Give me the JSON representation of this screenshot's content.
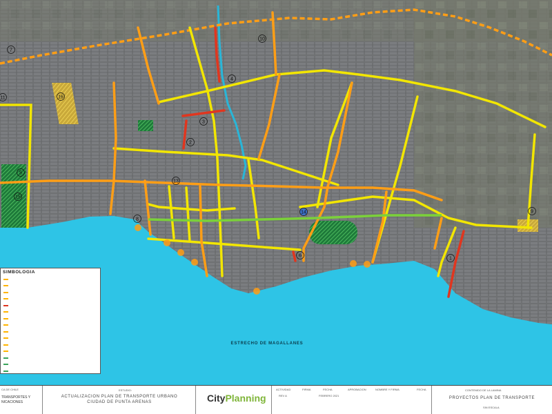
{
  "map": {
    "road_labels": [
      "1",
      "2",
      "3",
      "4",
      "5",
      "6",
      "7",
      "8",
      "9",
      "10",
      "11",
      "13",
      "14",
      "15",
      "16"
    ],
    "sea_label": "ESTRECHO DE MAGALLANES"
  },
  "legend": {
    "title": "SIMBOLOGIA",
    "items": [
      {
        "text": "",
        "color": "#ffb400"
      },
      {
        "text": "",
        "color": "#ffb400"
      },
      {
        "text": "",
        "color": "#ffb400"
      },
      {
        "text": "",
        "color": "#ffb400"
      },
      {
        "text": "",
        "color": "#e0361f"
      },
      {
        "text": "",
        "color": "#ffb400"
      },
      {
        "text": "",
        "color": "#ffb400"
      },
      {
        "text": "",
        "color": "#ffb400"
      },
      {
        "text": "",
        "color": "#ffb400"
      },
      {
        "text": "",
        "color": "#ffb400"
      },
      {
        "text": "",
        "color": "#ffb400"
      },
      {
        "text": "",
        "color": "#ffb400"
      },
      {
        "text": "",
        "color": "#3aa35a"
      },
      {
        "text": "",
        "color": "#3aa35a"
      },
      {
        "text": "",
        "color": "#3aa35a"
      },
      {
        "text": "",
        "color": "#ffb400"
      }
    ]
  },
  "titleblock": {
    "client_line1": "TRANSPORTES Y",
    "client_line2": "NICACIONES",
    "client_top": "CA DE CHILE",
    "estudio_label": "ESTUDIO:",
    "estudio_line1": "ACTUALIZACION PLAN DE TRANSPORTE URBANO",
    "estudio_line2": "CIUDAD DE PUNTA ARENAS",
    "logo_part1": "City",
    "logo_part2": "Planning",
    "col_actividad": "ACTIVIDAD",
    "col_firma": "FIRMA",
    "col_fecha": "FECHA",
    "col_aprobacion": "APROBACION",
    "col_nombre_firma": "NOMBRE Y FIRMA",
    "col_fecha2": "FECHA",
    "rev": "REV A",
    "date": "FEBRERO 2021",
    "contenido_label": "CONTENIDO DE LA LAMINA",
    "contenido": "PROYECTOS PLAN DE TRANSPORTE",
    "escala": "SIN ESCALA"
  },
  "colors": {
    "sea": "#2ec4e6",
    "land": "#6d6f72",
    "yellow_road": "#f2e600",
    "orange_road": "#ff9e16",
    "red_road": "#e0361f",
    "green_road": "#7bd13a"
  }
}
